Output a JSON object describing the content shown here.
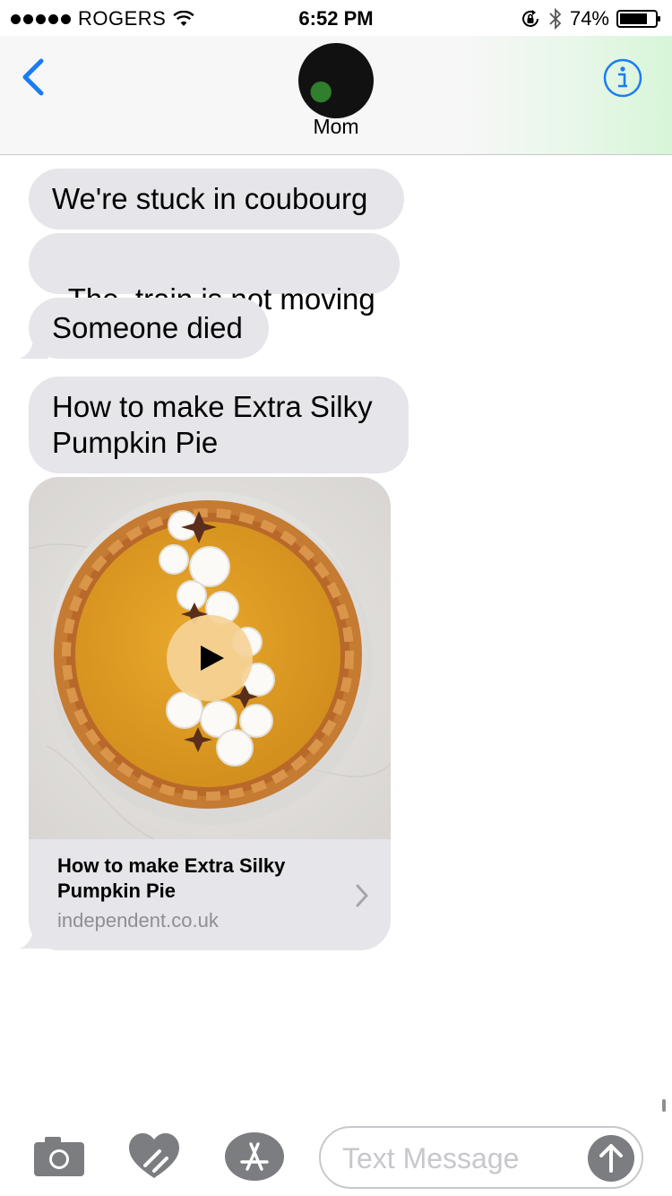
{
  "status_bar": {
    "carrier": "ROGERS",
    "time": "6:52 PM",
    "battery": "74%",
    "icons": [
      "signal-dots",
      "wifi-icon",
      "rotation-lock-icon",
      "bluetooth-icon",
      "battery-icon"
    ]
  },
  "header": {
    "contact_name": "Mom",
    "back_icon": "chevron-left-icon",
    "info_icon": "info-icon",
    "accent_color": "#1a7cf5"
  },
  "messages": [
    {
      "text": "We're stuck in coubourg"
    },
    {
      "text": "The  train is not moving"
    },
    {
      "text": "Someone died"
    },
    {
      "text": "How to make Extra Silky Pumpkin Pie"
    }
  ],
  "link_preview": {
    "title": "How to make Extra Silky Pumpkin Pie",
    "domain": "independent.co.uk",
    "media": "pumpkin-pie-video-thumbnail",
    "play_icon": "play-icon"
  },
  "input_bar": {
    "placeholder": "Text Message",
    "icons": [
      "camera-icon",
      "digital-touch-icon",
      "app-store-icon",
      "send-arrow-icon"
    ]
  },
  "colors": {
    "bubble_gray": "#e5e5ea",
    "ios_blue": "#1a7cf5",
    "icon_gray": "#7b7d80"
  }
}
